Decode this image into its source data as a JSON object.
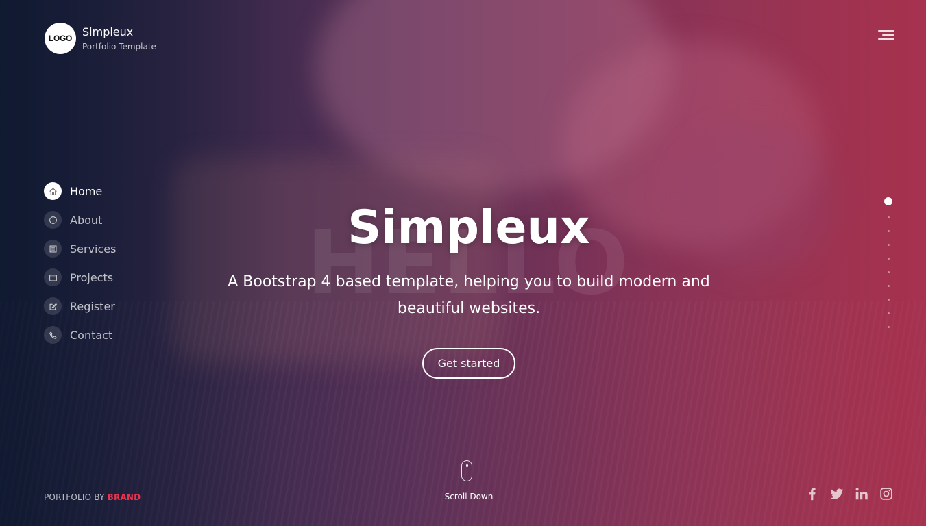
{
  "brand": {
    "logo_text": "LOGO",
    "name": "Simpleux",
    "tagline": "Portfolio Template"
  },
  "nav": {
    "items": [
      {
        "label": "Home",
        "icon": "home-icon",
        "active": true
      },
      {
        "label": "About",
        "icon": "info-icon",
        "active": false
      },
      {
        "label": "Services",
        "icon": "list-icon",
        "active": false
      },
      {
        "label": "Projects",
        "icon": "folder-icon",
        "active": false
      },
      {
        "label": "Register",
        "icon": "edit-icon",
        "active": false
      },
      {
        "label": "Contact",
        "icon": "phone-icon",
        "active": false
      }
    ]
  },
  "hero": {
    "background_word": "HELLO",
    "title": "Simpleux",
    "subtitle": "A Bootstrap 4 based template, helping you to build modern and beautiful websites.",
    "cta_label": "Get started"
  },
  "scroll": {
    "label": "Scroll Down"
  },
  "section_dots": {
    "count": 10,
    "active_index": 0
  },
  "footer": {
    "credit_prefix": "PORTFOLIO BY",
    "credit_brand": "BRAND"
  },
  "socials": [
    "facebook-icon",
    "twitter-icon",
    "linkedin-icon",
    "instagram-icon"
  ],
  "colors": {
    "accent": "#e8334f",
    "gradient_left": "#15203b",
    "gradient_right": "#ab3550"
  }
}
